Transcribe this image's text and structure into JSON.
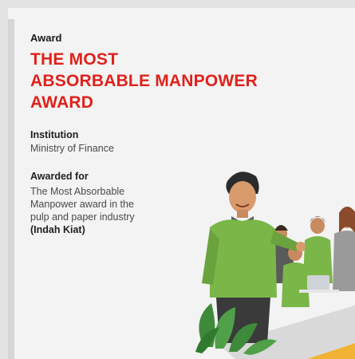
{
  "award": {
    "eyebrow": "Award",
    "title_line1": "THE MOST",
    "title_line2": "ABSORBABLE MANPOWER",
    "title_line3": "AWARD"
  },
  "institution": {
    "label": "Institution",
    "value": "Ministry of Finance"
  },
  "awarded_for": {
    "label": "Awarded for",
    "line1": "The Most Absorbable",
    "line2": "Manpower award in the",
    "line3": "pulp and paper industry",
    "company": "(Indah Kiat)"
  },
  "colors": {
    "accent_red": "#e0211b",
    "shirt_green": "#7ab648",
    "leaf_green": "#3f8a3a",
    "background": "#f3f3f3"
  }
}
